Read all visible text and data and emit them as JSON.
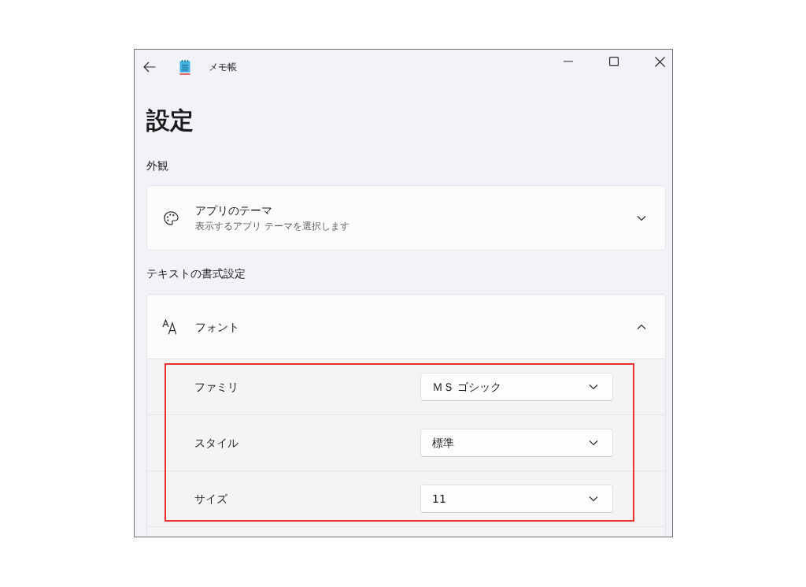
{
  "window": {
    "title": "メモ帳"
  },
  "page_title": "設定",
  "sections": [
    {
      "heading": "外観",
      "cards": [
        {
          "title": "アプリのテーマ",
          "subtitle": "表示するアプリ テーマを選択します",
          "expanded": false,
          "highlighted": false
        }
      ]
    },
    {
      "heading": "テキストの書式設定",
      "cards": [
        {
          "title": "フォント",
          "expanded": true,
          "highlighted": true,
          "settings": [
            {
              "label": "ファミリ",
              "value": "ＭＳ ゴシック"
            },
            {
              "label": "スタイル",
              "value": "標準"
            },
            {
              "label": "サイズ",
              "value": "11"
            }
          ]
        }
      ]
    }
  ]
}
